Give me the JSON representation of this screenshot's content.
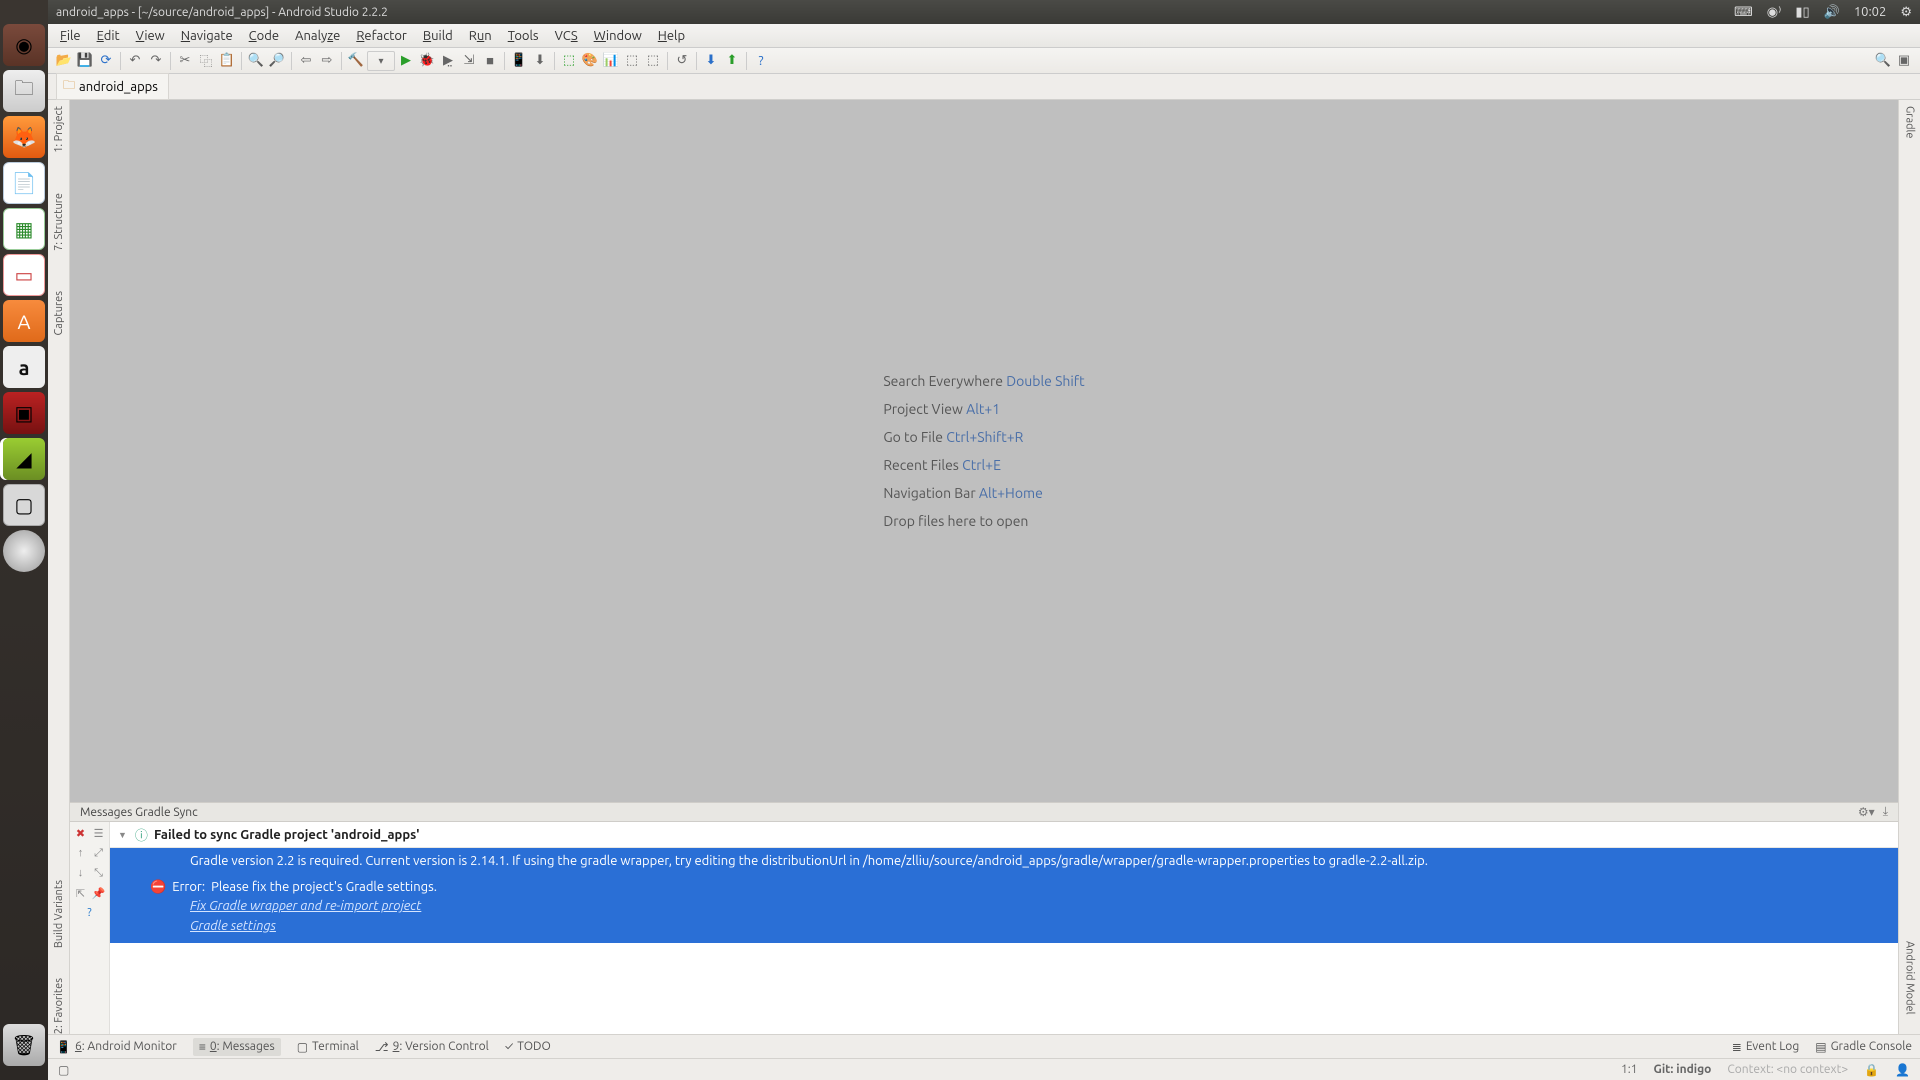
{
  "system": {
    "title": "android_apps - [~/source/android_apps] - Android Studio 2.2.2",
    "clock": "10:02"
  },
  "menu": {
    "file": "File",
    "edit": "Edit",
    "view": "View",
    "navigate": "Navigate",
    "code": "Code",
    "analyze": "Analyze",
    "refactor": "Refactor",
    "build": "Build",
    "run": "Run",
    "tools": "Tools",
    "vcs": "VCS",
    "window": "Window",
    "help": "Help"
  },
  "breadcrumb": {
    "root": "android_apps"
  },
  "left_tools": {
    "project": "1: Project",
    "structure": "7: Structure",
    "captures": "Captures",
    "build_variants": "Build Variants",
    "favorites": "2: Favorites"
  },
  "right_tools": {
    "gradle": "Gradle",
    "android_model": "Android Model"
  },
  "hints": {
    "search_label": "Search Everywhere",
    "search_key": "Double Shift",
    "project_label": "Project View",
    "project_key": "Alt+1",
    "goto_label": "Go to File",
    "goto_key": "Ctrl+Shift+R",
    "recent_label": "Recent Files",
    "recent_key": "Ctrl+E",
    "nav_label": "Navigation Bar",
    "nav_key": "Alt+Home",
    "drop": "Drop files here to open"
  },
  "messages": {
    "panel_title": "Messages Gradle Sync",
    "fail_title": "Failed to sync Gradle project 'android_apps'",
    "detail": "Gradle version 2.2 is required. Current version is 2.14.1. If using the gradle wrapper, try editing the distributionUrl in /home/zlliu/source/android_apps/gradle/wrapper/gradle-wrapper.properties to gradle-2.2-all.zip.",
    "error_label": "Error:",
    "error_text": "Please fix the project's Gradle settings.",
    "link1": "Fix Gradle wrapper and re-import project",
    "link2": "Gradle settings"
  },
  "bottom_tabs": {
    "monitor": "6: Android Monitor",
    "messages": "0: Messages",
    "terminal": "Terminal",
    "vcs": "9: Version Control",
    "todo": "TODO",
    "event_log": "Event Log",
    "gradle_console": "Gradle Console"
  },
  "status": {
    "pos": "1:1",
    "git": "Git: indigo",
    "context": "Context: <no context>"
  }
}
